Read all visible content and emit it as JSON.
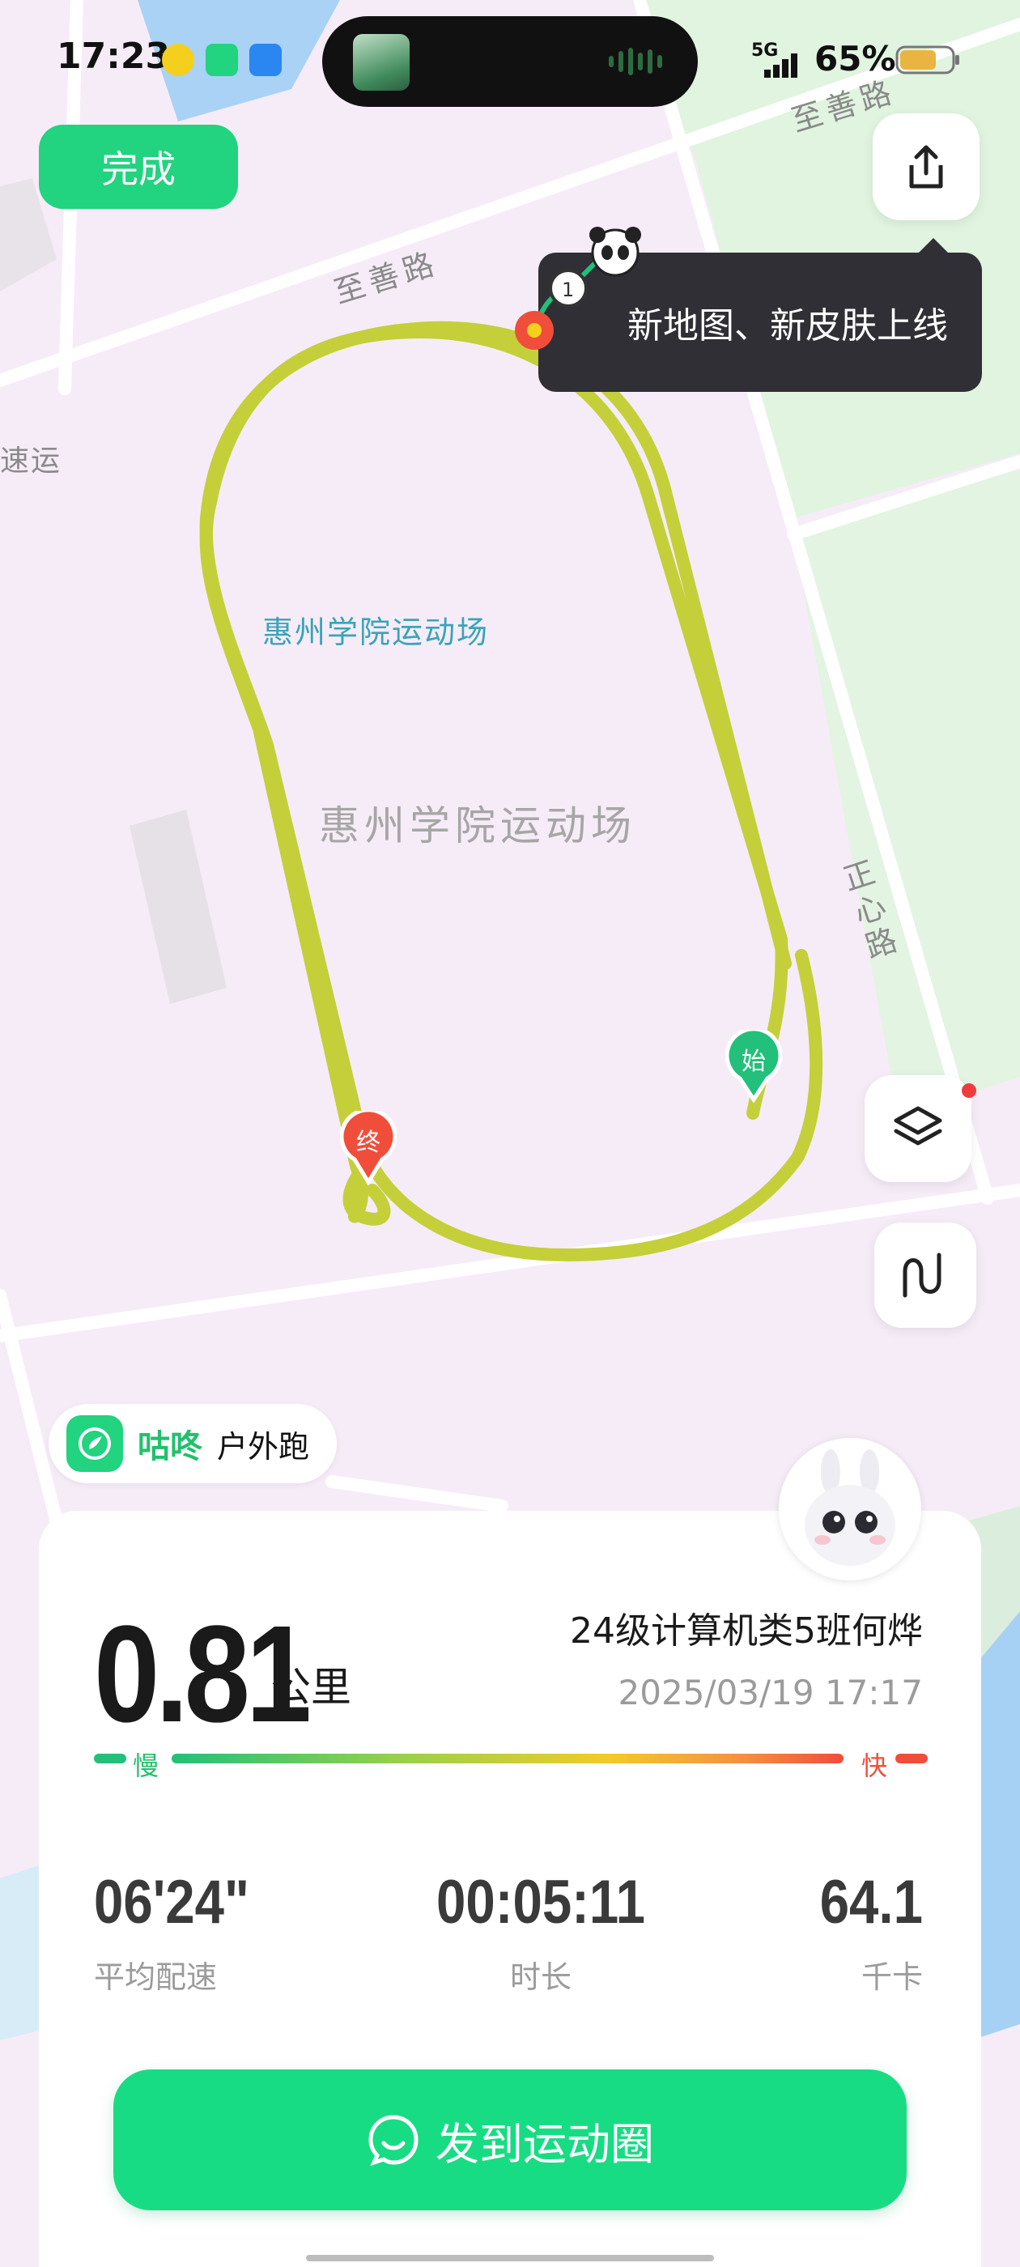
{
  "status_bar": {
    "time": "17:23",
    "network": "5G",
    "battery": "65%"
  },
  "map": {
    "road_labels": [
      "至善路",
      "至善路",
      "正心路",
      "速运"
    ],
    "place_label_small": "惠州学院运动场",
    "place_label_large": "惠州学院运动场",
    "start_marker": "始",
    "end_marker": "终",
    "route_color": "#c5cf3a"
  },
  "toolbar": {
    "done_label": "完成",
    "tooltip": "新地图、新皮肤上线"
  },
  "badge": {
    "brand": "咕咚",
    "type": "户外跑"
  },
  "summary": {
    "distance": "0.81",
    "distance_unit": "公里",
    "user": "24级计算机类5班何烨",
    "datetime": "2025/03/19 17:17",
    "pace_slow": "慢",
    "pace_fast": "快"
  },
  "stats": [
    {
      "value": "06'24\"",
      "label": "平均配速"
    },
    {
      "value": "00:05:11",
      "label": "时长"
    },
    {
      "value": "64.1",
      "label": "千卡"
    }
  ],
  "post_button": {
    "label": "发到运动圈"
  },
  "colors": {
    "accent": "#22d37f",
    "end_red": "#f04e3a",
    "map_bg": "#f6ecf7",
    "green_area": "#dff3de"
  }
}
